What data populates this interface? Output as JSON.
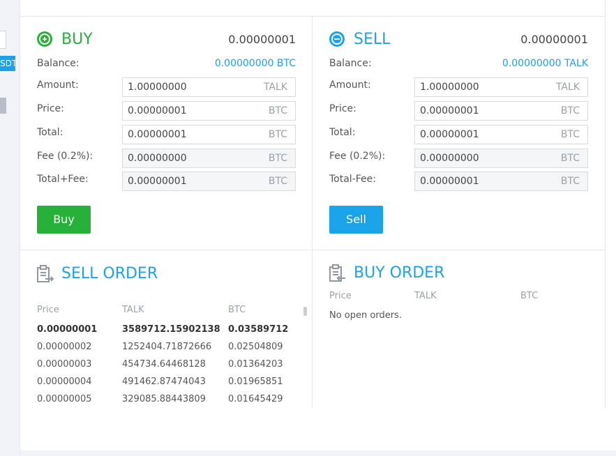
{
  "sidebar": {
    "badge_label": "SDT"
  },
  "buy": {
    "title": "BUY",
    "price": "0.00000001",
    "balance_label": "Balance:",
    "balance_value": "0.00000000 BTC",
    "fields": [
      {
        "label": "Amount:",
        "value": "1.00000000",
        "unit": "TALK"
      },
      {
        "label": "Price:",
        "value": "0.00000001",
        "unit": "BTC"
      },
      {
        "label": "Total:",
        "value": "0.00000001",
        "unit": "BTC"
      },
      {
        "label": "Fee (0.2%):",
        "value": "0.00000000",
        "unit": "BTC"
      },
      {
        "label": "Total+Fee:",
        "value": "0.00000001",
        "unit": "BTC"
      }
    ],
    "button_label": "Buy"
  },
  "sell": {
    "title": "SELL",
    "price": "0.00000001",
    "balance_label": "Balance:",
    "balance_value": "0.00000000 TALK",
    "fields": [
      {
        "label": "Amount:",
        "value": "1.00000000",
        "unit": "TALK"
      },
      {
        "label": "Price:",
        "value": "0.00000001",
        "unit": "BTC"
      },
      {
        "label": "Total:",
        "value": "0.00000001",
        "unit": "BTC"
      },
      {
        "label": "Fee (0.2%):",
        "value": "0.00000000",
        "unit": "BTC"
      },
      {
        "label": "Total-Fee:",
        "value": "0.00000001",
        "unit": "BTC"
      }
    ],
    "button_label": "Sell"
  },
  "sell_order": {
    "title": "SELL ORDER",
    "columns": [
      "Price",
      "TALK",
      "BTC"
    ],
    "rows": [
      [
        "0.00000001",
        "3589712.15902138",
        "0.03589712"
      ],
      [
        "0.00000002",
        "1252404.71872666",
        "0.02504809"
      ],
      [
        "0.00000003",
        "454734.64468128",
        "0.01364203"
      ],
      [
        "0.00000004",
        "491462.87474043",
        "0.01965851"
      ],
      [
        "0.00000005",
        "329085.88443809",
        "0.01645429"
      ]
    ]
  },
  "buy_order": {
    "title": "BUY ORDER",
    "columns": [
      "Price",
      "TALK",
      "BTC"
    ],
    "empty_text": "No open orders."
  },
  "colors": {
    "buy_green": "#27b03a",
    "sell_blue": "#1aa3e8"
  }
}
